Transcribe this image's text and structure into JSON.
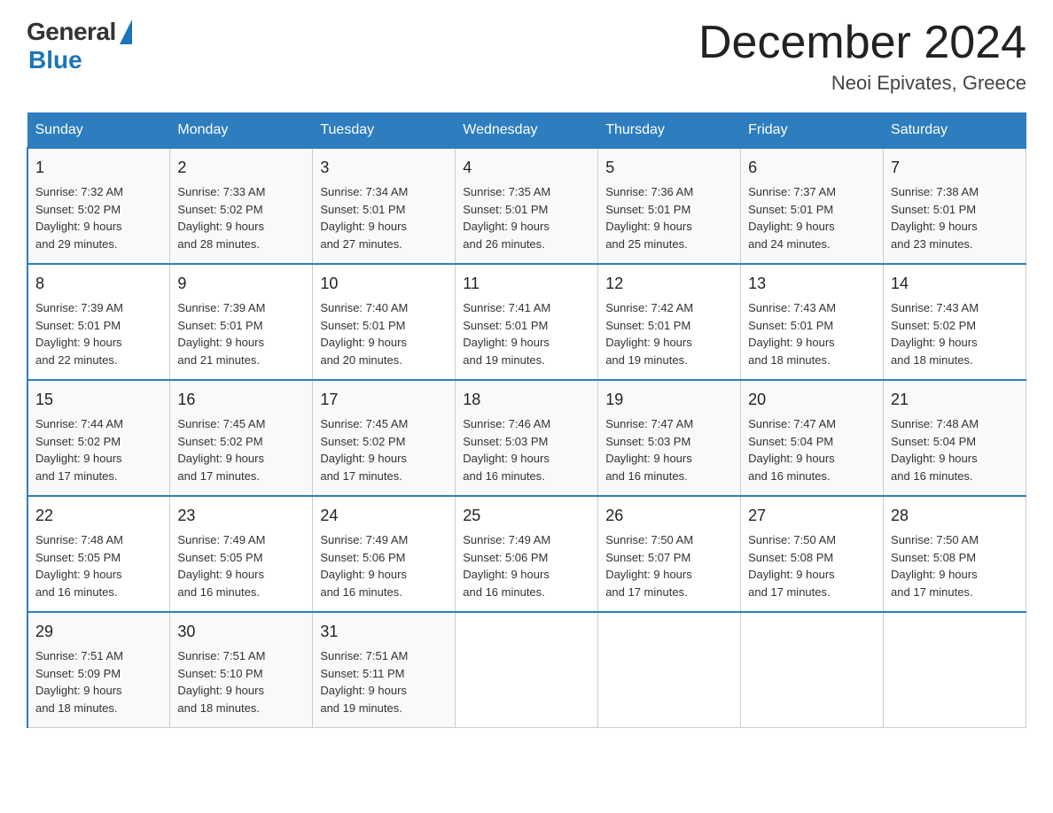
{
  "logo": {
    "general": "General",
    "blue": "Blue",
    "tagline": "Blue"
  },
  "header": {
    "month": "December 2024",
    "location": "Neoi Epivates, Greece"
  },
  "weekdays": [
    "Sunday",
    "Monday",
    "Tuesday",
    "Wednesday",
    "Thursday",
    "Friday",
    "Saturday"
  ],
  "rows": [
    [
      {
        "day": "1",
        "sunrise": "7:32 AM",
        "sunset": "5:02 PM",
        "daylight": "9 hours and 29 minutes."
      },
      {
        "day": "2",
        "sunrise": "7:33 AM",
        "sunset": "5:02 PM",
        "daylight": "9 hours and 28 minutes."
      },
      {
        "day": "3",
        "sunrise": "7:34 AM",
        "sunset": "5:01 PM",
        "daylight": "9 hours and 27 minutes."
      },
      {
        "day": "4",
        "sunrise": "7:35 AM",
        "sunset": "5:01 PM",
        "daylight": "9 hours and 26 minutes."
      },
      {
        "day": "5",
        "sunrise": "7:36 AM",
        "sunset": "5:01 PM",
        "daylight": "9 hours and 25 minutes."
      },
      {
        "day": "6",
        "sunrise": "7:37 AM",
        "sunset": "5:01 PM",
        "daylight": "9 hours and 24 minutes."
      },
      {
        "day": "7",
        "sunrise": "7:38 AM",
        "sunset": "5:01 PM",
        "daylight": "9 hours and 23 minutes."
      }
    ],
    [
      {
        "day": "8",
        "sunrise": "7:39 AM",
        "sunset": "5:01 PM",
        "daylight": "9 hours and 22 minutes."
      },
      {
        "day": "9",
        "sunrise": "7:39 AM",
        "sunset": "5:01 PM",
        "daylight": "9 hours and 21 minutes."
      },
      {
        "day": "10",
        "sunrise": "7:40 AM",
        "sunset": "5:01 PM",
        "daylight": "9 hours and 20 minutes."
      },
      {
        "day": "11",
        "sunrise": "7:41 AM",
        "sunset": "5:01 PM",
        "daylight": "9 hours and 19 minutes."
      },
      {
        "day": "12",
        "sunrise": "7:42 AM",
        "sunset": "5:01 PM",
        "daylight": "9 hours and 19 minutes."
      },
      {
        "day": "13",
        "sunrise": "7:43 AM",
        "sunset": "5:01 PM",
        "daylight": "9 hours and 18 minutes."
      },
      {
        "day": "14",
        "sunrise": "7:43 AM",
        "sunset": "5:02 PM",
        "daylight": "9 hours and 18 minutes."
      }
    ],
    [
      {
        "day": "15",
        "sunrise": "7:44 AM",
        "sunset": "5:02 PM",
        "daylight": "9 hours and 17 minutes."
      },
      {
        "day": "16",
        "sunrise": "7:45 AM",
        "sunset": "5:02 PM",
        "daylight": "9 hours and 17 minutes."
      },
      {
        "day": "17",
        "sunrise": "7:45 AM",
        "sunset": "5:02 PM",
        "daylight": "9 hours and 17 minutes."
      },
      {
        "day": "18",
        "sunrise": "7:46 AM",
        "sunset": "5:03 PM",
        "daylight": "9 hours and 16 minutes."
      },
      {
        "day": "19",
        "sunrise": "7:47 AM",
        "sunset": "5:03 PM",
        "daylight": "9 hours and 16 minutes."
      },
      {
        "day": "20",
        "sunrise": "7:47 AM",
        "sunset": "5:04 PM",
        "daylight": "9 hours and 16 minutes."
      },
      {
        "day": "21",
        "sunrise": "7:48 AM",
        "sunset": "5:04 PM",
        "daylight": "9 hours and 16 minutes."
      }
    ],
    [
      {
        "day": "22",
        "sunrise": "7:48 AM",
        "sunset": "5:05 PM",
        "daylight": "9 hours and 16 minutes."
      },
      {
        "day": "23",
        "sunrise": "7:49 AM",
        "sunset": "5:05 PM",
        "daylight": "9 hours and 16 minutes."
      },
      {
        "day": "24",
        "sunrise": "7:49 AM",
        "sunset": "5:06 PM",
        "daylight": "9 hours and 16 minutes."
      },
      {
        "day": "25",
        "sunrise": "7:49 AM",
        "sunset": "5:06 PM",
        "daylight": "9 hours and 16 minutes."
      },
      {
        "day": "26",
        "sunrise": "7:50 AM",
        "sunset": "5:07 PM",
        "daylight": "9 hours and 17 minutes."
      },
      {
        "day": "27",
        "sunrise": "7:50 AM",
        "sunset": "5:08 PM",
        "daylight": "9 hours and 17 minutes."
      },
      {
        "day": "28",
        "sunrise": "7:50 AM",
        "sunset": "5:08 PM",
        "daylight": "9 hours and 17 minutes."
      }
    ],
    [
      {
        "day": "29",
        "sunrise": "7:51 AM",
        "sunset": "5:09 PM",
        "daylight": "9 hours and 18 minutes."
      },
      {
        "day": "30",
        "sunrise": "7:51 AM",
        "sunset": "5:10 PM",
        "daylight": "9 hours and 18 minutes."
      },
      {
        "day": "31",
        "sunrise": "7:51 AM",
        "sunset": "5:11 PM",
        "daylight": "9 hours and 19 minutes."
      },
      null,
      null,
      null,
      null
    ]
  ]
}
